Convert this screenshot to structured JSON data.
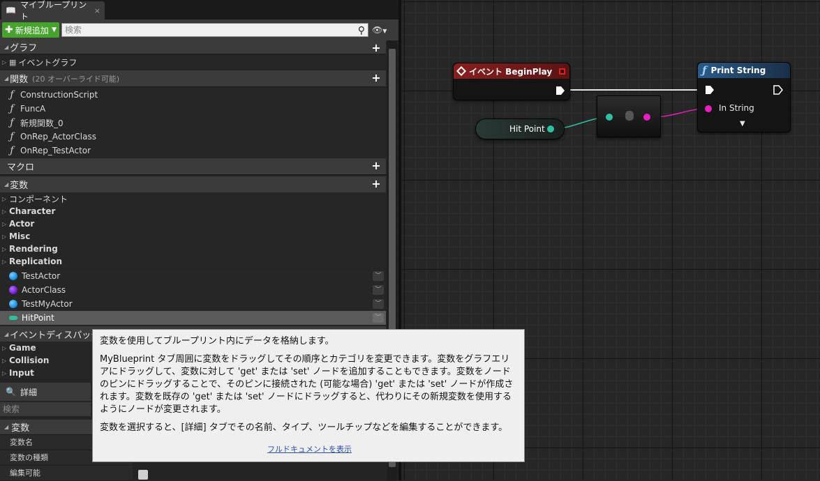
{
  "tab": {
    "title": "マイブループリント",
    "close": "×"
  },
  "toolbar": {
    "add_label": "新規追加",
    "search_placeholder": "検索"
  },
  "sections": {
    "graph": {
      "label": "グラフ"
    },
    "event_graph": {
      "label": "イベントグラフ"
    },
    "functions": {
      "label": "関数",
      "hint": "(20 オーバーライド可能)"
    },
    "macros": {
      "label": "マクロ"
    },
    "variables": {
      "label": "変数"
    },
    "dispatchers": {
      "label": "イベントディスパッチャー"
    }
  },
  "functions": [
    {
      "label": "ConstructionScript"
    },
    {
      "label": "FuncA"
    },
    {
      "label": "新規関数_0"
    },
    {
      "label": "OnRep_ActorClass"
    },
    {
      "label": "OnRep_TestActor"
    }
  ],
  "var_categories": [
    {
      "label": "コンポーネント",
      "bold": false
    },
    {
      "label": "Character",
      "bold": true
    },
    {
      "label": "Actor",
      "bold": true
    },
    {
      "label": "Misc",
      "bold": true
    },
    {
      "label": "Rendering",
      "bold": true
    },
    {
      "label": "Replication",
      "bold": true
    }
  ],
  "variables": [
    {
      "label": "TestActor",
      "color": "#1e90e0",
      "kind": "orb"
    },
    {
      "label": "ActorClass",
      "color": "#7a1fd0",
      "kind": "orb"
    },
    {
      "label": "TestMyActor",
      "color": "#1e90e0",
      "kind": "orb"
    },
    {
      "label": "HitPoint",
      "color": "#30c0a0",
      "kind": "pill"
    }
  ],
  "dispatcher_categories": [
    {
      "label": "Game"
    },
    {
      "label": "Collision"
    },
    {
      "label": "Input"
    }
  ],
  "details": {
    "tab": "詳細",
    "search_placeholder": "検索",
    "section": "変数",
    "rows": [
      {
        "label": "変数名"
      },
      {
        "label": "変数の種類"
      },
      {
        "label": "編集可能"
      }
    ]
  },
  "graph_nodes": {
    "begin_play": {
      "title": "イベント BeginPlay",
      "header_color": "#8a1e1e"
    },
    "print_string": {
      "title": "Print String",
      "header_color": "#2b5a86",
      "pin_label": "In String"
    },
    "hit_point": {
      "label": "Hit Point"
    }
  },
  "tooltip": {
    "p1": "変数を使用してブループリント内にデータを格納します。",
    "p2": "MyBlueprint タブ周囲に変数をドラッグしてその順序とカテゴリを変更できます。変数をグラフエリアにドラッグして、変数に対して 'get' または 'set' ノードを追加することもできます。変数をノードのピンにドラッグすることで、そのピンに接続された (可能な場合) 'get' または 'set' ノードが作成されます。変数を既存の 'get' または 'set' ノードにドラッグすると、代わりにその新規変数を使用するようにノードが変更されます。",
    "p3": "変数を選択すると、[詳細] タブでその名前、タイプ、ツールチップなどを編集することができます。",
    "link": "フルドキュメントを表示"
  }
}
